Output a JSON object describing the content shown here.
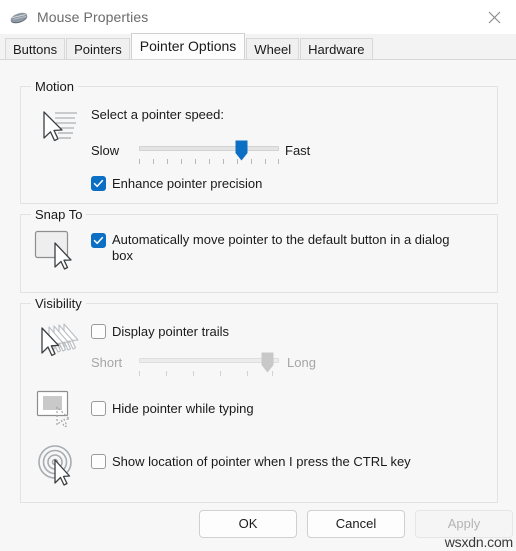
{
  "window": {
    "title": "Mouse Properties",
    "icon": "mouse-icon",
    "close_icon": "close-icon"
  },
  "tabs": [
    {
      "label": "Buttons",
      "active": false
    },
    {
      "label": "Pointers",
      "active": false
    },
    {
      "label": "Pointer Options",
      "active": true
    },
    {
      "label": "Wheel",
      "active": false
    },
    {
      "label": "Hardware",
      "active": false
    }
  ],
  "motion": {
    "legend": "Motion",
    "icon": "pointer-speed-icon",
    "prompt": "Select a pointer speed:",
    "slow_label": "Slow",
    "fast_label": "Fast",
    "speed_value": 7,
    "speed_ticks": 11,
    "enhance_precision": {
      "label": "Enhance pointer precision",
      "checked": true
    }
  },
  "snap_to": {
    "legend": "Snap To",
    "icon": "snap-to-button-icon",
    "auto_move": {
      "label": "Automatically move pointer to the default button in a dialog box",
      "checked": true
    }
  },
  "visibility": {
    "legend": "Visibility",
    "trails_icon": "pointer-trails-icon",
    "typing_icon": "hide-while-typing-icon",
    "ctrl_icon": "locate-pointer-icon",
    "display_trails": {
      "label": "Display pointer trails",
      "checked": false
    },
    "trails_slider": {
      "short_label": "Short",
      "long_label": "Long",
      "value": 6,
      "ticks": 6,
      "enabled": false
    },
    "hide_typing": {
      "label": "Hide pointer while typing",
      "checked": false
    },
    "show_location": {
      "label": "Show location of pointer when I press the CTRL key",
      "checked": false
    }
  },
  "footer": {
    "ok": "OK",
    "cancel": "Cancel",
    "apply": "Apply",
    "apply_disabled": true
  },
  "watermark": "wsxdn.com",
  "colors": {
    "accent": "#0b6fc4",
    "window_bg": "#f7f7f7",
    "titlebar_bg": "#ffffff"
  }
}
